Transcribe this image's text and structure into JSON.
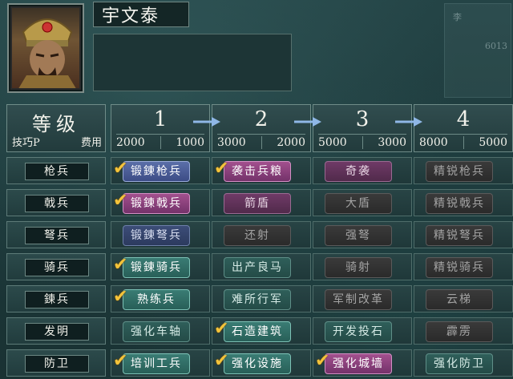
{
  "officer": {
    "name": "宇文泰"
  },
  "ghost_panel": {
    "text1": "李",
    "text2": "6013"
  },
  "table": {
    "header_left": {
      "title": "等级",
      "sub_left": "技巧P",
      "sub_right": "费用"
    },
    "tiers": [
      {
        "num": "1",
        "skill_pts": "2000",
        "cost": "1000"
      },
      {
        "num": "2",
        "skill_pts": "3000",
        "cost": "2000"
      },
      {
        "num": "3",
        "skill_pts": "5000",
        "cost": "3000"
      },
      {
        "num": "4",
        "skill_pts": "8000",
        "cost": "5000"
      }
    ],
    "rows": [
      {
        "label": "枪兵",
        "cells": [
          {
            "text": "锻鍊枪兵",
            "state": "learned-blue",
            "checked": true
          },
          {
            "text": "袭击兵粮",
            "state": "learned-pink",
            "checked": true
          },
          {
            "text": "奇袭",
            "state": "available-pink",
            "checked": false
          },
          {
            "text": "精锐枪兵",
            "state": "locked",
            "checked": false
          }
        ]
      },
      {
        "label": "戟兵",
        "cells": [
          {
            "text": "锻鍊戟兵",
            "state": "learned-pink",
            "checked": true
          },
          {
            "text": "箭盾",
            "state": "available-pink",
            "checked": false
          },
          {
            "text": "大盾",
            "state": "locked",
            "checked": false
          },
          {
            "text": "精锐戟兵",
            "state": "locked",
            "checked": false
          }
        ]
      },
      {
        "label": "弩兵",
        "cells": [
          {
            "text": "锻鍊弩兵",
            "state": "available-blue",
            "checked": false
          },
          {
            "text": "还射",
            "state": "locked",
            "checked": false
          },
          {
            "text": "强弩",
            "state": "locked",
            "checked": false
          },
          {
            "text": "精锐弩兵",
            "state": "locked",
            "checked": false
          }
        ]
      },
      {
        "label": "骑兵",
        "cells": [
          {
            "text": "锻鍊骑兵",
            "state": "learned-teal",
            "checked": true
          },
          {
            "text": "出产良马",
            "state": "available-teal",
            "checked": false
          },
          {
            "text": "骑射",
            "state": "locked",
            "checked": false
          },
          {
            "text": "精锐骑兵",
            "state": "locked",
            "checked": false
          }
        ]
      },
      {
        "label": "鍊兵",
        "cells": [
          {
            "text": "熟练兵",
            "state": "learned-teal",
            "checked": true
          },
          {
            "text": "难所行军",
            "state": "available-teal",
            "checked": false
          },
          {
            "text": "军制改革",
            "state": "locked",
            "checked": false
          },
          {
            "text": "云梯",
            "state": "locked",
            "checked": false
          }
        ]
      },
      {
        "label": "发明",
        "cells": [
          {
            "text": "强化车轴",
            "state": "available-teal",
            "checked": false
          },
          {
            "text": "石造建筑",
            "state": "learned-teal",
            "checked": true
          },
          {
            "text": "开发投石",
            "state": "available-teal",
            "checked": false
          },
          {
            "text": "霹雳",
            "state": "locked",
            "checked": false
          }
        ]
      },
      {
        "label": "防卫",
        "cells": [
          {
            "text": "培训工兵",
            "state": "learned-teal",
            "checked": true
          },
          {
            "text": "强化设施",
            "state": "learned-teal",
            "checked": true
          },
          {
            "text": "强化城墙",
            "state": "learned-pink",
            "checked": true
          },
          {
            "text": "强化防卫",
            "state": "available-teal",
            "checked": false
          }
        ]
      }
    ]
  },
  "colors": {
    "check": "#f4c33a",
    "arrow": "#8fb7e6"
  }
}
